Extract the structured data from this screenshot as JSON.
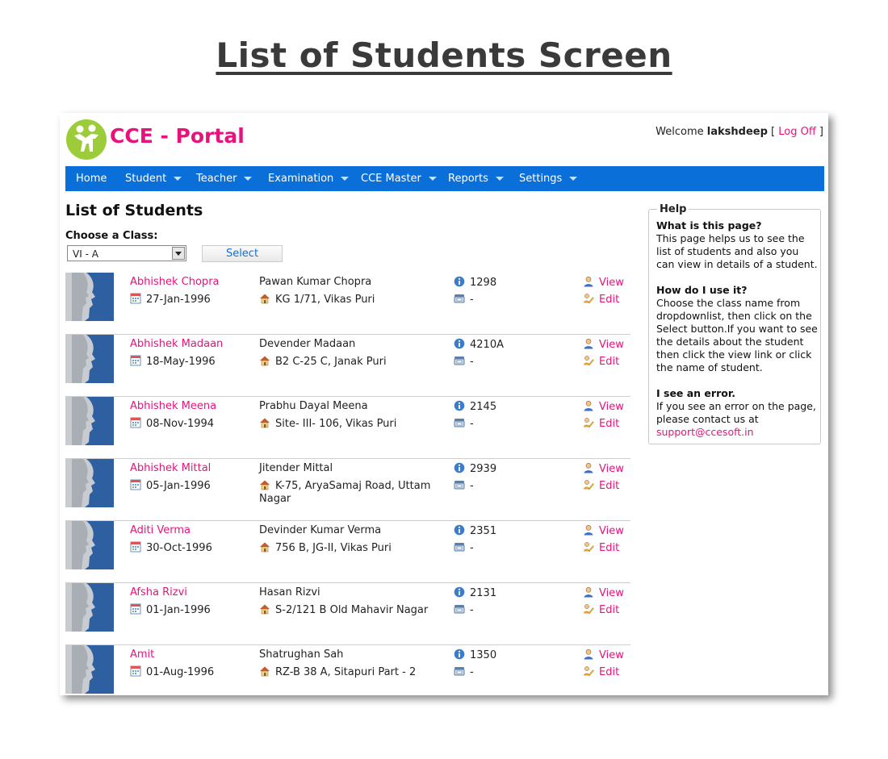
{
  "page_heading": "List of Students Screen",
  "app": {
    "title": "CCE - Portal",
    "welcome_prefix": "Welcome",
    "username": "lakshdeep",
    "logoff_label": "Log Off"
  },
  "nav": [
    {
      "label": "Home"
    },
    {
      "label": "Student"
    },
    {
      "label": "Teacher"
    },
    {
      "label": "Examination"
    },
    {
      "label": "CCE Master"
    },
    {
      "label": "Reports"
    },
    {
      "label": "Settings"
    }
  ],
  "main": {
    "title": "List of Students",
    "choose_label": "Choose a Class:",
    "class_selected": "VI - A",
    "select_label": "Select"
  },
  "students": [
    {
      "name": "Abhishek Chopra",
      "dob": "27-Jan-1996",
      "parent": "Pawan Kumar Chopra",
      "address": "KG 1/71, Vikas Puri",
      "admission_no": "1298",
      "phone": "-",
      "view": "View",
      "edit": "Edit"
    },
    {
      "name": "Abhishek Madaan",
      "dob": "18-May-1996",
      "parent": "Devender Madaan",
      "address": "B2 C-25 C, Janak Puri",
      "admission_no": "4210A",
      "phone": "-",
      "view": "View",
      "edit": "Edit"
    },
    {
      "name": "Abhishek Meena",
      "dob": "08-Nov-1994",
      "parent": "Prabhu Dayal Meena",
      "address": "Site- III- 106, Vikas Puri",
      "admission_no": "2145",
      "phone": "-",
      "view": "View",
      "edit": "Edit"
    },
    {
      "name": "Abhishek Mittal",
      "dob": "05-Jan-1996",
      "parent": "Jitender Mittal",
      "address": "K-75, AryaSamaj Road, Uttam Nagar",
      "admission_no": "2939",
      "phone": "-",
      "view": "View",
      "edit": "Edit"
    },
    {
      "name": "Aditi Verma",
      "dob": "30-Oct-1996",
      "parent": "Devinder Kumar Verma",
      "address": "756 B, JG-II, Vikas Puri",
      "admission_no": "2351",
      "phone": "-",
      "view": "View",
      "edit": "Edit"
    },
    {
      "name": "Afsha Rizvi",
      "dob": "01-Jan-1996",
      "parent": "Hasan Rizvi",
      "address": "S-2/121 B Old Mahavir Nagar",
      "admission_no": "2131",
      "phone": "-",
      "view": "View",
      "edit": "Edit"
    },
    {
      "name": "Amit",
      "dob": "01-Aug-1996",
      "parent": "Shatrughan Sah",
      "address": "RZ-B 38 A, Sitapuri Part - 2",
      "admission_no": "1350",
      "phone": "-",
      "view": "View",
      "edit": "Edit"
    }
  ],
  "help": {
    "legend": "Help",
    "q1": "What is this page?",
    "a1": "This page helps us to see the list of students and also you can view in details of a student.",
    "q2": "How do I use it?",
    "a2": "Choose the class name from dropdownlist, then click on the Select button.If you want to see the details about the student then click the view link or click the name of student.",
    "q3": "I see an error.",
    "a3": "If you see an error on the page, please contact us at",
    "email": "support@ccesoft.in"
  },
  "icons": {
    "logo": "people-logo-icon",
    "dob": "calendar-icon",
    "address": "house-icon",
    "admission": "info-icon",
    "phone": "telephone-icon",
    "view": "person-icon",
    "edit": "edit-pencil-icon"
  },
  "colors": {
    "accent": "#e8137a",
    "nav": "#0b6fd9",
    "logo": "#9dcc3a",
    "avatar": "#2e5fa0"
  }
}
